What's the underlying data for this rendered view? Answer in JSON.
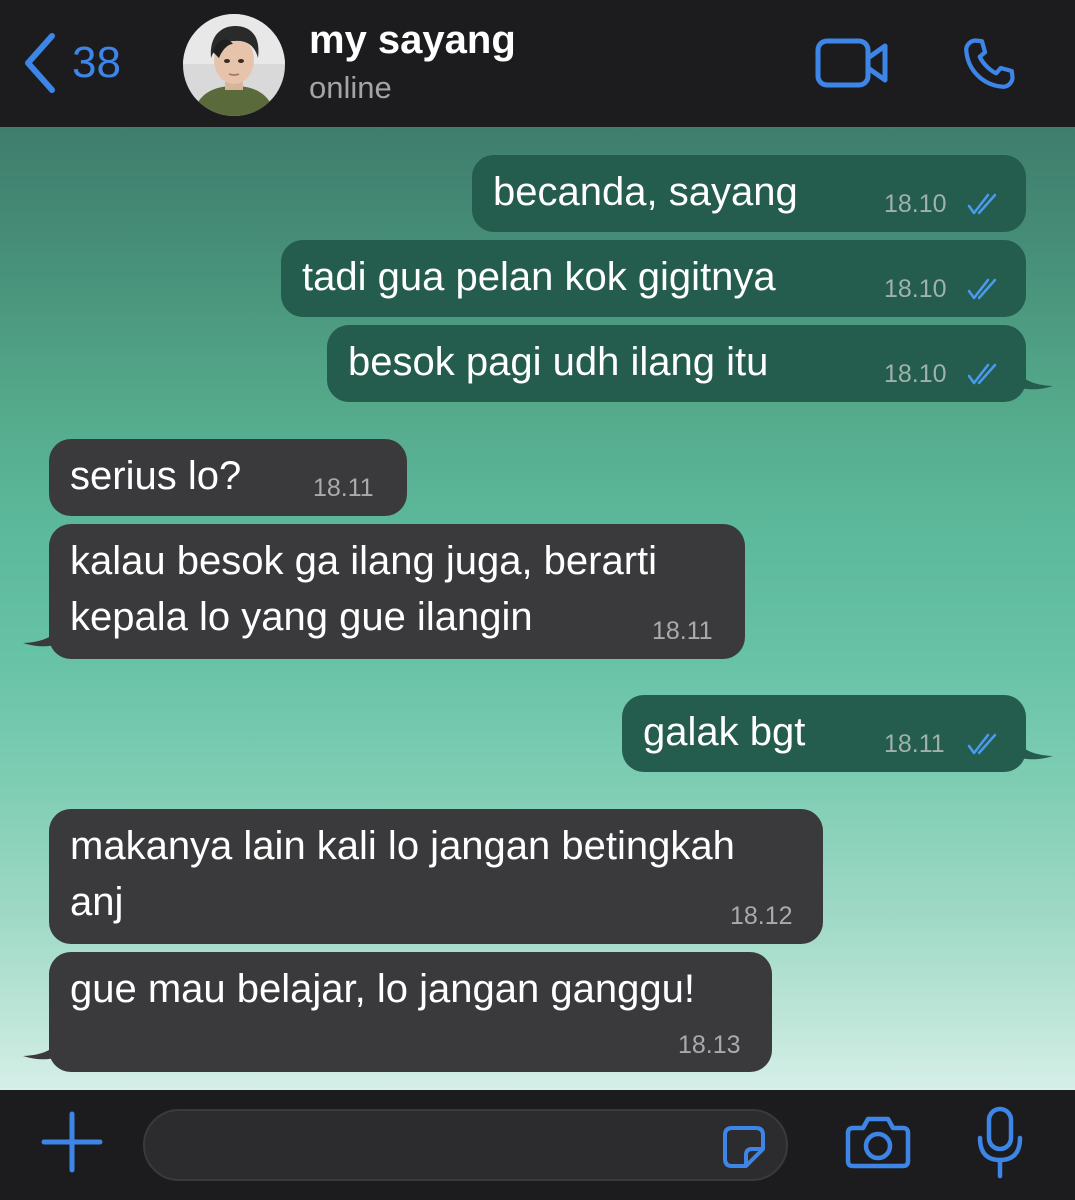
{
  "colors": {
    "accent": "#3d86e8",
    "outgoing_bubble": "#245c4d",
    "incoming_bubble": "#3a3a3c",
    "header_bg": "#1c1c1e",
    "read_ticks": "#4a9bf0"
  },
  "header": {
    "back_count": "38",
    "contact_name": "my sayang",
    "status": "online",
    "icons": [
      "chevron-left-icon",
      "avatar-photo",
      "video-camera-icon",
      "phone-icon"
    ]
  },
  "messages": [
    {
      "direction": "out",
      "text": "becanda, sayang",
      "time": "18.10",
      "status": "read"
    },
    {
      "direction": "out",
      "text": "tadi gua pelan kok gigitnya",
      "time": "18.10",
      "status": "read"
    },
    {
      "direction": "out",
      "text": "besok pagi udh ilang itu",
      "time": "18.10",
      "status": "read"
    },
    {
      "direction": "in",
      "text": "serius lo?",
      "time": "18.11"
    },
    {
      "direction": "in",
      "text": "kalau besok ga ilang juga, berarti\nkepala lo yang gue ilangin",
      "time": "18.11"
    },
    {
      "direction": "out",
      "text": "galak bgt",
      "time": "18.11",
      "status": "read"
    },
    {
      "direction": "in",
      "text": "makanya lain kali lo jangan betingkah\nanj",
      "time": "18.12"
    },
    {
      "direction": "in",
      "text": "gue mau belajar, lo jangan ganggu!",
      "time": "18.13"
    }
  ],
  "composer": {
    "value": "",
    "icons": [
      "plus-icon",
      "sticker-icon",
      "camera-icon",
      "microphone-icon"
    ]
  }
}
